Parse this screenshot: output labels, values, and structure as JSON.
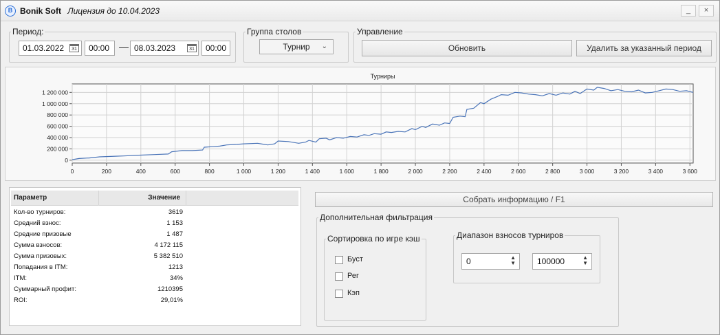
{
  "titlebar": {
    "app_name": "Bonik Soft",
    "license": "Лицензия до 10.04.2023",
    "logo_letter": "B",
    "minimize": "_",
    "close": "×"
  },
  "period": {
    "label": "Период:",
    "start_date": "01.03.2022",
    "start_time": "00:00",
    "separator": "—",
    "end_date": "08.03.2023",
    "end_time": "00:00",
    "calendar_glyph": "31"
  },
  "table_group": {
    "label": "Группа столов",
    "selected": "Турнир"
  },
  "control": {
    "label": "Управление",
    "refresh": "Обновить",
    "delete_period": "Удалить за указанный период"
  },
  "chart_data": {
    "type": "line",
    "title": "Турниры",
    "xlabel": "",
    "ylabel": "",
    "xlim": [
      0,
      3619
    ],
    "ylim": [
      -50000,
      1350000
    ],
    "xticks": [
      0,
      200,
      400,
      600,
      800,
      1000,
      1200,
      1400,
      1600,
      1800,
      2000,
      2200,
      2400,
      2600,
      2800,
      3000,
      3200,
      3400,
      3600
    ],
    "xtick_labels": [
      "0",
      "200",
      "400",
      "600",
      "800",
      "1 000",
      "1 200",
      "1 400",
      "1 600",
      "1 800",
      "2 000",
      "2 200",
      "2 400",
      "2 600",
      "2 800",
      "3 000",
      "3 200",
      "3 400",
      "3 600"
    ],
    "yticks": [
      0,
      200000,
      400000,
      600000,
      800000,
      1000000,
      1200000
    ],
    "ytick_labels": [
      "0",
      "200 000",
      "400 000",
      "600 000",
      "800 000",
      "1 000 000",
      "1 200 000"
    ],
    "grid": true,
    "line_color": "#4a74b8",
    "series": [
      {
        "x": [
          0,
          40,
          100,
          160,
          250,
          300,
          400,
          480,
          560,
          580,
          640,
          700,
          760,
          770,
          820,
          860,
          900,
          960,
          1000,
          1080,
          1140,
          1180,
          1200,
          1260,
          1320,
          1360,
          1380,
          1420,
          1440,
          1480,
          1500,
          1540,
          1580,
          1620,
          1660,
          1700,
          1730,
          1760,
          1800,
          1830,
          1860,
          1900,
          1940,
          1980,
          2000,
          2040,
          2060,
          2100,
          2140,
          2170,
          2200,
          2220,
          2260,
          2290,
          2300,
          2340,
          2380,
          2400,
          2440,
          2480,
          2500,
          2540,
          2580,
          2620,
          2660,
          2700,
          2740,
          2780,
          2820,
          2860,
          2900,
          2930,
          2960,
          3000,
          3040,
          3060,
          3100,
          3140,
          3180,
          3220,
          3260,
          3300,
          3340,
          3380,
          3420,
          3460,
          3500,
          3540,
          3580,
          3619
        ],
        "y": [
          10000,
          30000,
          40000,
          60000,
          70000,
          75000,
          90000,
          100000,
          110000,
          150000,
          170000,
          170000,
          180000,
          230000,
          240000,
          250000,
          270000,
          280000,
          290000,
          300000,
          270000,
          290000,
          340000,
          330000,
          300000,
          320000,
          350000,
          320000,
          380000,
          390000,
          360000,
          400000,
          390000,
          420000,
          410000,
          450000,
          440000,
          470000,
          460000,
          500000,
          490000,
          510000,
          500000,
          560000,
          540000,
          600000,
          580000,
          640000,
          620000,
          660000,
          650000,
          760000,
          780000,
          770000,
          900000,
          920000,
          1020000,
          1000000,
          1080000,
          1130000,
          1160000,
          1150000,
          1200000,
          1190000,
          1170000,
          1160000,
          1140000,
          1180000,
          1150000,
          1190000,
          1170000,
          1220000,
          1180000,
          1260000,
          1240000,
          1290000,
          1270000,
          1230000,
          1250000,
          1220000,
          1210000,
          1240000,
          1190000,
          1200000,
          1230000,
          1260000,
          1250000,
          1220000,
          1230000,
          1200000
        ]
      }
    ]
  },
  "stats_table": {
    "col_param": "Параметр",
    "col_value": "Значение",
    "rows": [
      {
        "k": "Кол-во турниров:",
        "v": "3619"
      },
      {
        "k": "Средний взнос:",
        "v": "1 153"
      },
      {
        "k": "Средние призовые",
        "v": "1 487"
      },
      {
        "k": "Сумма взносов:",
        "v": "4 172 115"
      },
      {
        "k": "Сумма призовых:",
        "v": "5 382 510"
      },
      {
        "k": "Попадания в ITM:",
        "v": "1213"
      },
      {
        "k": "ITM:",
        "v": "34%"
      },
      {
        "k": "Суммарный профит:",
        "v": "1210395"
      },
      {
        "k": "ROI:",
        "v": "29,01%"
      }
    ]
  },
  "collect_button": "Собрать информацию / F1",
  "extra_filter": {
    "label": "Дополнительная фильтрация",
    "sort_group": {
      "label": "Сортировка по игре кэш",
      "options": [
        "Буст",
        "Рег",
        "Кэп"
      ]
    },
    "range_group": {
      "label": "Диапазон взносов турниров",
      "min": "0",
      "max": "100000"
    }
  }
}
